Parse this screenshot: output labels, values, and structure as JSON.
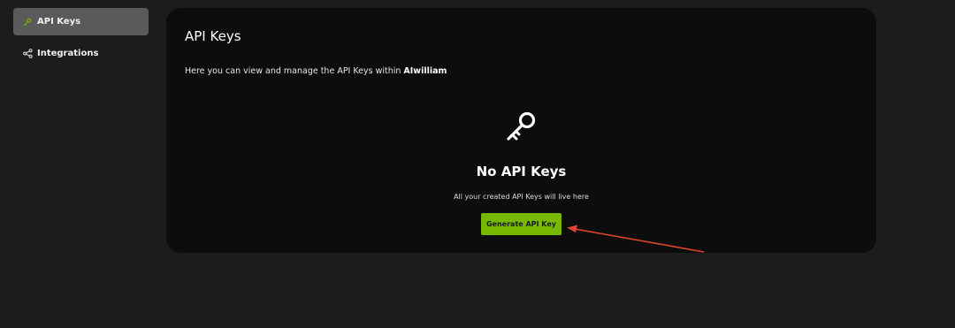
{
  "sidebar": {
    "items": [
      {
        "label": "API Keys",
        "icon": "key-icon",
        "active": true
      },
      {
        "label": "Integrations",
        "icon": "integrations-icon",
        "active": false
      }
    ]
  },
  "main": {
    "title": "API Keys",
    "description_prefix": "Here you can view and manage the API Keys within ",
    "org_name": "AIwilliam",
    "empty_state": {
      "icon": "key-icon",
      "title": "No API Keys",
      "subtitle": "All your created API Keys will live here",
      "button_label": "Generate API Key"
    }
  },
  "colors": {
    "page_bg": "#1c1c1c",
    "card_bg": "#0d0d0d",
    "active_nav_bg": "#5a5a5a",
    "accent": "#76b900",
    "annotation_arrow": "#e0442c"
  }
}
